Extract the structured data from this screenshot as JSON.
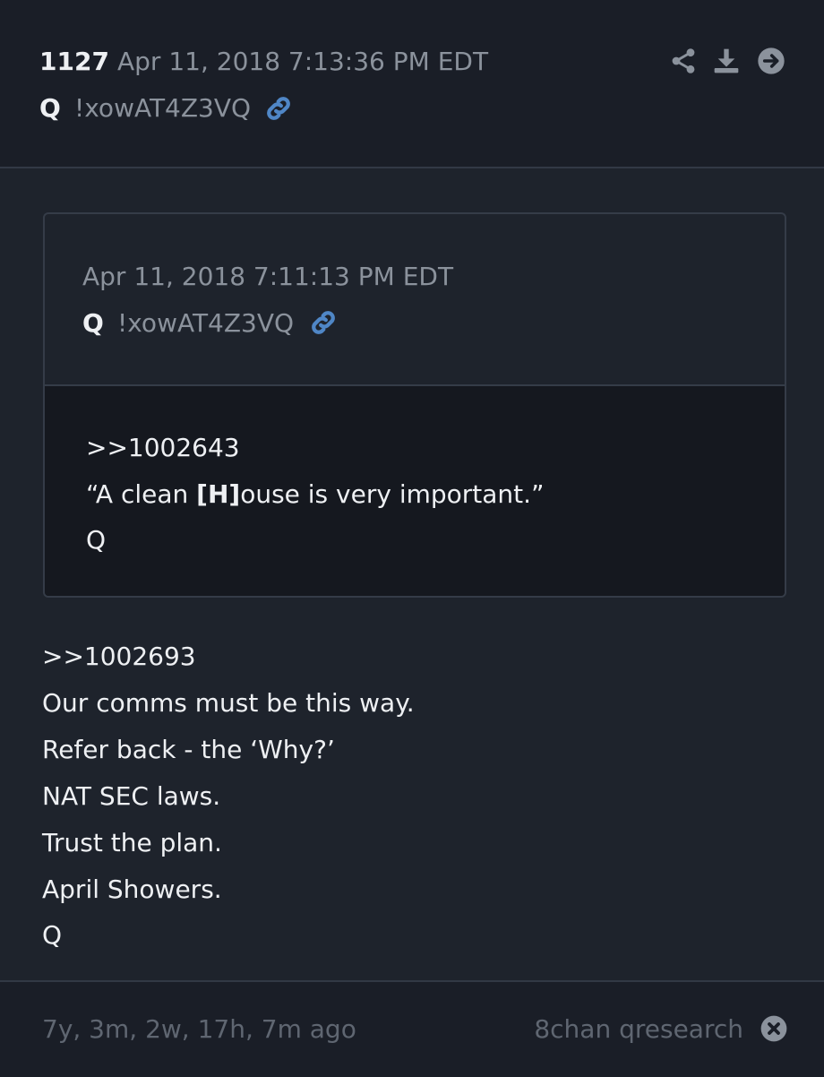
{
  "post": {
    "number": "1127",
    "date": "Apr 11, 2018 7:13:36 PM EDT",
    "author": "Q",
    "tripcode": "!xowAT4Z3VQ"
  },
  "header_icons": [
    "share-icon",
    "download-icon",
    "arrow-right-circle-icon"
  ],
  "quoted": {
    "date": "Apr 11, 2018 7:11:13 PM EDT",
    "author": "Q",
    "tripcode": "!xowAT4Z3VQ",
    "ref": ">>1002643",
    "line2_pre": "“A clean ",
    "line2_bold": "[H]",
    "line2_post": "ouse is very important.”",
    "sign": "Q"
  },
  "message": {
    "lines": [
      ">>1002693",
      "Our comms must be this way.",
      "Refer back - the ‘Why?’",
      "NAT SEC laws.",
      "Trust the plan.",
      "April Showers.",
      "Q"
    ]
  },
  "footer": {
    "ago": "7y, 3m, 2w, 17h, 7m ago",
    "source": "8chan qresearch"
  },
  "colors": {
    "background": "#1e232c",
    "header_bg": "#1a1e27",
    "quote_body_bg": "#15181f",
    "link_blue": "#4f86c6",
    "muted_text": "#8b929c"
  }
}
